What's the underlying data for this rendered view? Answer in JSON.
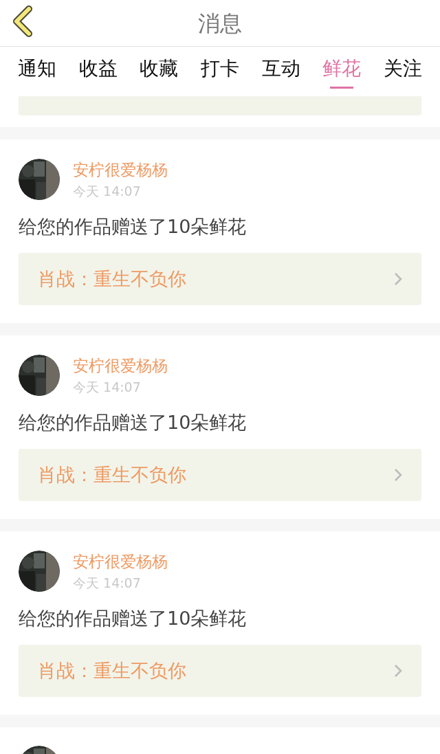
{
  "header": {
    "title": "消息"
  },
  "tabs": [
    {
      "label": "通知",
      "selected": false
    },
    {
      "label": "收益",
      "selected": false
    },
    {
      "label": "收藏",
      "selected": false
    },
    {
      "label": "打卡",
      "selected": false
    },
    {
      "label": "互动",
      "selected": false
    },
    {
      "label": "鲜花",
      "selected": true
    },
    {
      "label": "关注",
      "selected": false
    }
  ],
  "messages": [
    {
      "user": "安柠很爱杨杨",
      "time": "今天 14:07",
      "text": "给您的作品赠送了10朵鲜花",
      "work": "肖战：重生不负你"
    },
    {
      "user": "安柠很爱杨杨",
      "time": "今天 14:07",
      "text": "给您的作品赠送了10朵鲜花",
      "work": "肖战：重生不负你"
    },
    {
      "user": "安柠很爱杨杨",
      "time": "今天 14:07",
      "text": "给您的作品赠送了10朵鲜花",
      "work": "肖战：重生不负你"
    }
  ]
}
